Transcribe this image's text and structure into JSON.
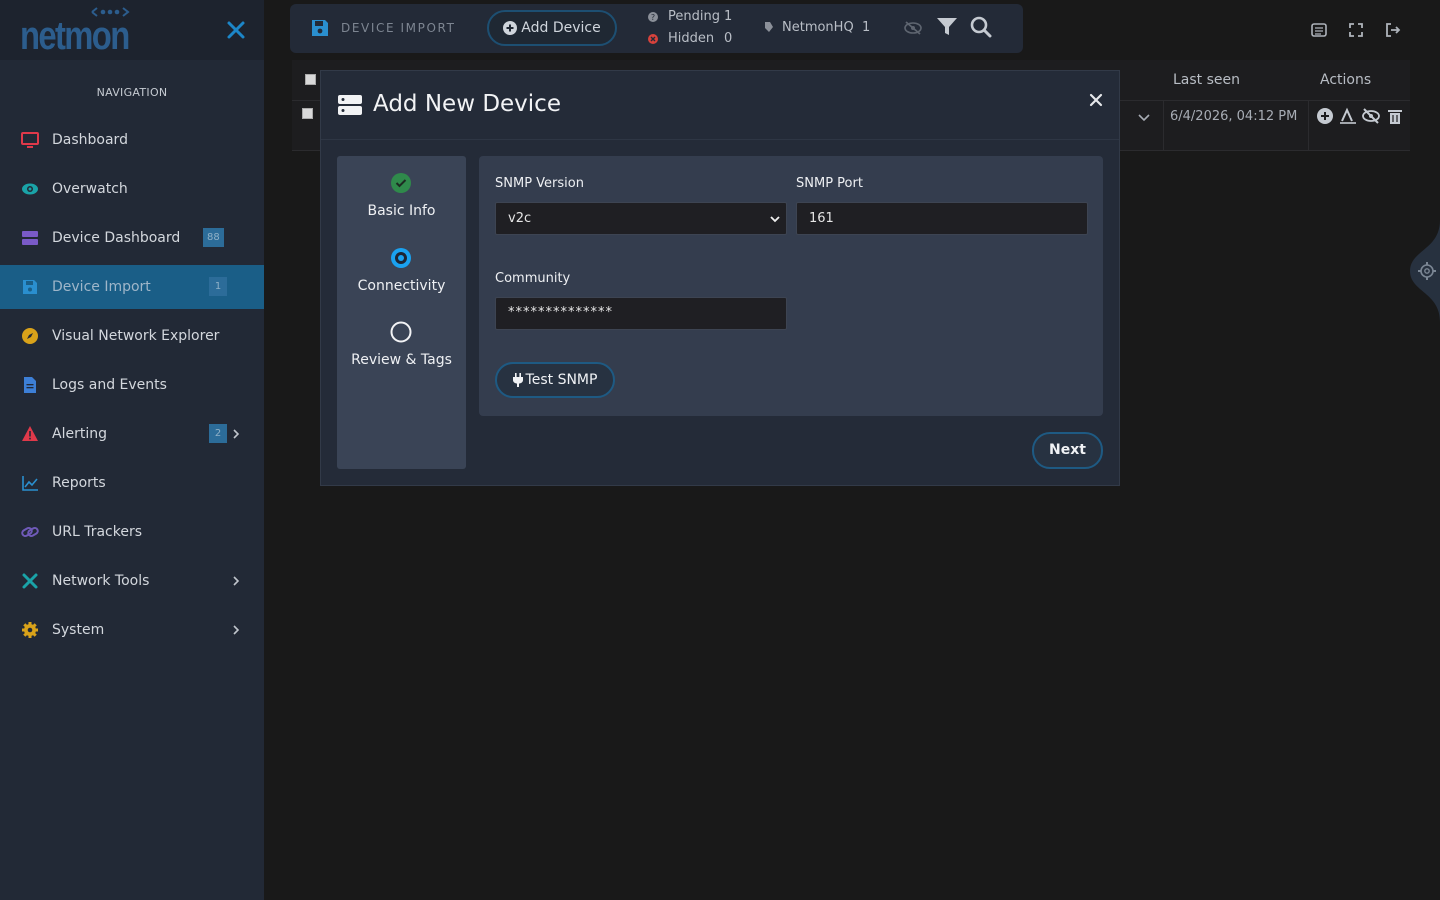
{
  "sidebar": {
    "logo_text": "netmon",
    "nav_title": "NAVIGATION",
    "items": [
      {
        "label": "Dashboard",
        "icon": "monitor-icon",
        "color": "#e0394a"
      },
      {
        "label": "Overwatch",
        "icon": "eye-icon",
        "color": "#1aa3a8"
      },
      {
        "label": "Device Dashboard",
        "icon": "server-icon",
        "color": "#7a5ac8",
        "badge": "88"
      },
      {
        "label": "Device Import",
        "icon": "save-icon",
        "color": "#2a8fcf",
        "badge": "1",
        "active": true
      },
      {
        "label": "Visual Network Explorer",
        "icon": "compass-icon",
        "color": "#d9a21a"
      },
      {
        "label": "Logs and Events",
        "icon": "file-icon",
        "color": "#3d7fd6"
      },
      {
        "label": "Alerting",
        "icon": "warning-icon",
        "color": "#e0394a",
        "badge": "2"
      },
      {
        "label": "Reports",
        "icon": "chart-line-icon",
        "color": "#2a8fcf"
      },
      {
        "label": "URL Trackers",
        "icon": "link-icon",
        "color": "#6f5ab8"
      },
      {
        "label": "Network Tools",
        "icon": "tools-icon",
        "color": "#1aa3a8"
      },
      {
        "label": "System",
        "icon": "gear-icon",
        "color": "#d9a21a"
      }
    ]
  },
  "toolbar": {
    "title": "DEVICE IMPORT",
    "add_label": "Add Device",
    "pending_label": "Pending",
    "pending_count": "1",
    "hidden_label": "Hidden",
    "hidden_count": "0",
    "tag_label": "NetmonHQ",
    "tag_count": "1"
  },
  "table": {
    "headers": {
      "last_seen": "Last seen",
      "actions": "Actions"
    },
    "row": {
      "last_seen": "6/4/2026, 04:12 PM"
    }
  },
  "modal": {
    "title": "Add New Device",
    "steps": [
      {
        "label": "Basic Info",
        "state": "done"
      },
      {
        "label": "Connectivity",
        "state": "current"
      },
      {
        "label": "Review & Tags",
        "state": "pending"
      }
    ],
    "snmp_version_label": "SNMP Version",
    "snmp_version_value": "v2c",
    "snmp_port_label": "SNMP Port",
    "snmp_port_value": "161",
    "community_label": "Community",
    "community_value": "**************",
    "test_label": "Test SNMP",
    "next_label": "Next"
  },
  "colors": {
    "accent": "#2a8fcf",
    "success": "#2f8a4b",
    "danger": "#d7423c"
  }
}
